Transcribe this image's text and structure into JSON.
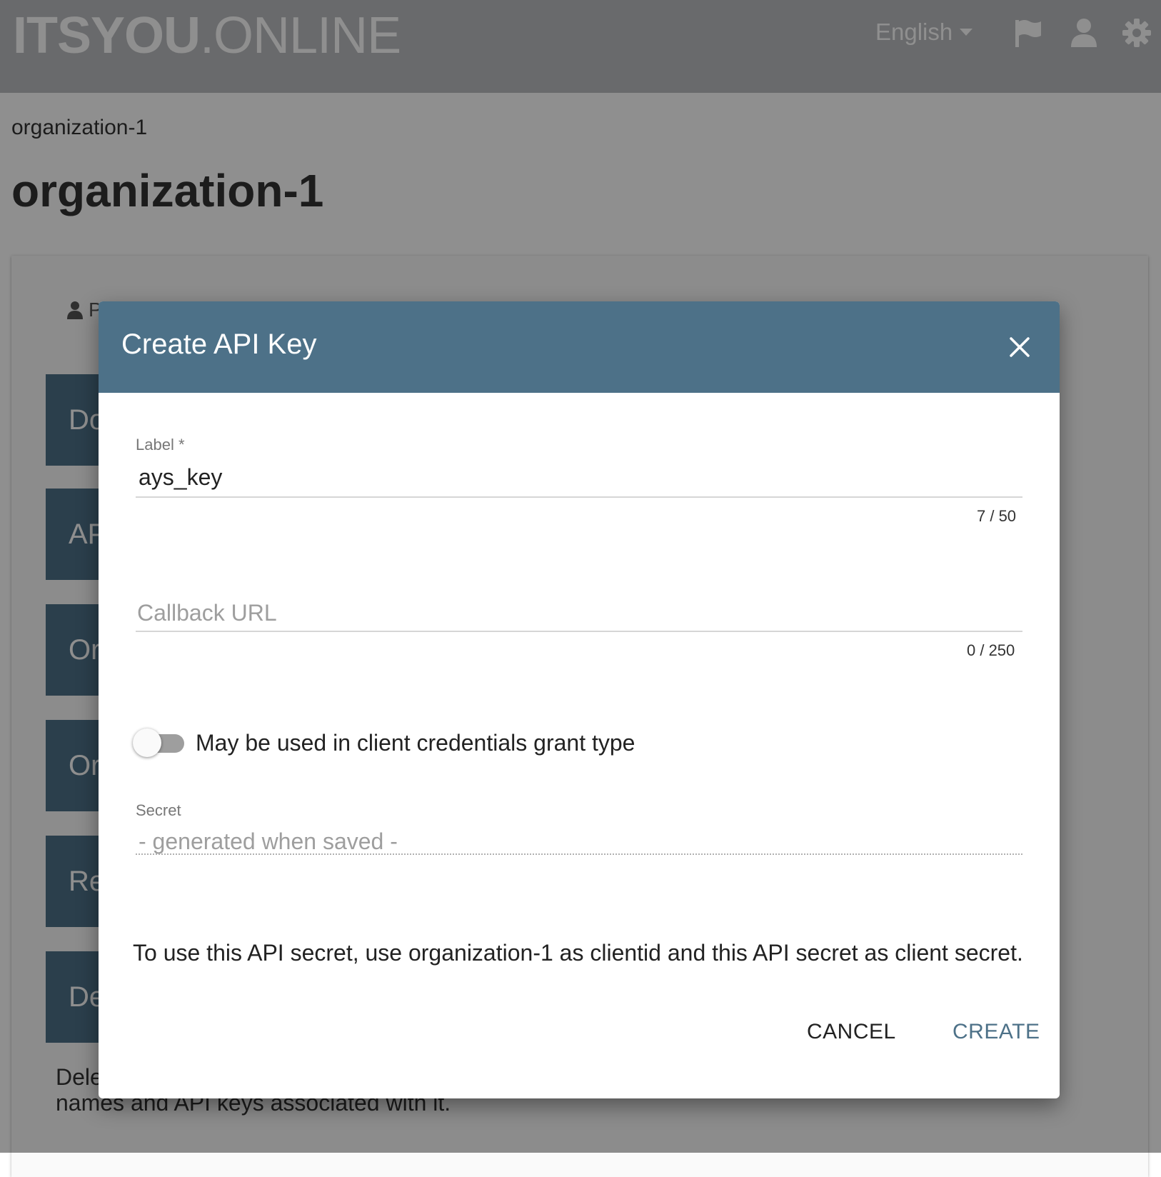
{
  "header": {
    "logo_bold": "ITSYOU",
    "logo_light": ".ONLINE",
    "language": "English",
    "icons": [
      "flag-icon",
      "user-icon",
      "gear-icon"
    ]
  },
  "page": {
    "breadcrumb": "organization-1",
    "title": "organization-1",
    "tab_label": "P",
    "nav_buttons": [
      "Dor",
      "API",
      "Org",
      "Org",
      "Rec",
      "Del"
    ],
    "delete_note": "Deleting an organization is irreversible and will delete all domain names and API keys associated with it."
  },
  "dialog": {
    "title": "Create API Key",
    "label_field": {
      "label": "Label *",
      "value": "ays_key",
      "counter": "7 / 50"
    },
    "callback_field": {
      "placeholder": "Callback URL",
      "counter": "0 / 250"
    },
    "toggle_label": "May be used in client credentials grant type",
    "toggle_on": false,
    "secret_field": {
      "label": "Secret",
      "value": "- generated when saved -"
    },
    "info": "To use this API secret, use organization-1 as clientid and this API secret as client secret.",
    "cancel_label": "CANCEL",
    "create_label": "CREATE"
  },
  "colors": {
    "accent": "#4d7188",
    "topbar": "#bcbdc0"
  }
}
